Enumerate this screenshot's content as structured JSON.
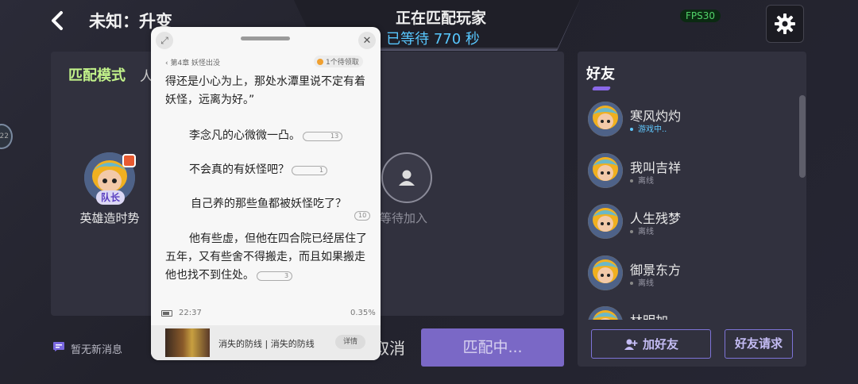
{
  "header": {
    "mode_title": "未知：升变",
    "match_status": "正在匹配玩家",
    "wait_time": "已等待 770 秒",
    "fps": "FPS30"
  },
  "lobby": {
    "match_mode_label": "匹配模式",
    "mode_extra": "人",
    "side_bubble": "22",
    "player": {
      "name": "英雄造时势",
      "badge": "队长"
    },
    "wait_slot_label": "等待加入",
    "message": "暂无新消息",
    "cancel_label": "取消",
    "matching_label": "匹配中..."
  },
  "friends": {
    "title": "好友",
    "items": [
      {
        "name": "寒风灼灼",
        "status": "游戏中..",
        "in_game": true
      },
      {
        "name": "我叫吉祥",
        "status": "离线",
        "in_game": false
      },
      {
        "name": "人生残梦",
        "status": "离线",
        "in_game": false
      },
      {
        "name": "御景东方",
        "status": "离线",
        "in_game": false
      },
      {
        "name": "林明加",
        "status": "",
        "in_game": false
      }
    ],
    "add_friend_label": "加好友",
    "friend_request_label": "好友请求"
  },
  "reader": {
    "chapter": "第4章 妖怪出没",
    "reward": "1个待领取",
    "paragraphs": {
      "p1": "得还是小心为上，那处水潭里说不定有着妖怪，远离为好。”",
      "p2": "李念凡的心微微一凸。",
      "p2_count": "13",
      "p3": "不会真的有妖怪吧？",
      "p3_count": "1",
      "p4": "自己养的那些鱼都被妖怪吃了？",
      "p4_count": "10",
      "p5": "他有些虚，但他在四合院已经居住了五年，又有些舍不得搬走，而且如果搬走他也找不到住处。",
      "p5_count": "3"
    },
    "time": "22:37",
    "progress": "0.35%",
    "book_title": "消失的防线 | 消失的防线",
    "detail_label": "详情"
  },
  "colors": {
    "accent_purple": "#7a68c6",
    "mode_label_green": "#c2f28a",
    "wait_blue": "#58c8ff"
  }
}
